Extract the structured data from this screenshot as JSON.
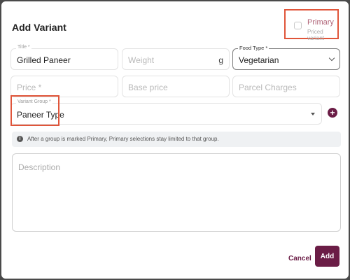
{
  "dialog": {
    "title": "Add Variant",
    "primary": {
      "label": "Primary",
      "sublabel": "Priced variant",
      "checked": false
    },
    "fields": {
      "title": {
        "label": "Title *",
        "value": "Grilled Paneer"
      },
      "weight": {
        "placeholder": "Weight",
        "unit": "g"
      },
      "food_type": {
        "label": "Food Type *",
        "value": "Vegetarian"
      },
      "price": {
        "placeholder": "Price *"
      },
      "base_price": {
        "placeholder": "Base price"
      },
      "parcel_charges": {
        "placeholder": "Parcel Charges"
      },
      "variant_group": {
        "label": "Variant Group *",
        "value": "Paneer Type"
      },
      "description": {
        "placeholder": "Description"
      }
    },
    "info_text": "After a group is marked Primary, Primary selections stay limited to that group.",
    "actions": {
      "cancel": "Cancel",
      "add": "Add"
    }
  },
  "colors": {
    "accent": "#6b1d46",
    "highlight": "#e0553a"
  },
  "icons": {
    "info": "info-icon",
    "add": "plus-icon",
    "chevron": "chevron-down-icon"
  }
}
